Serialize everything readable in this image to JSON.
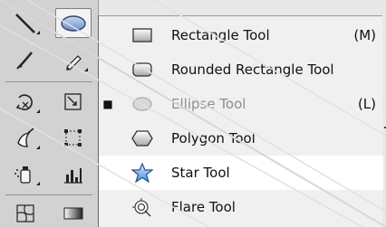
{
  "flyout": {
    "items": [
      {
        "label": "Rectangle Tool",
        "shortcut": "(M)",
        "checked": false,
        "dim": false,
        "selected": false
      },
      {
        "label": "Rounded Rectangle Tool",
        "shortcut": "",
        "checked": false,
        "dim": false,
        "selected": false
      },
      {
        "label": "Ellipse Tool",
        "shortcut": "(L)",
        "checked": true,
        "dim": true,
        "selected": false
      },
      {
        "label": "Polygon Tool",
        "shortcut": "",
        "checked": false,
        "dim": false,
        "selected": false
      },
      {
        "label": "Star Tool",
        "shortcut": "",
        "checked": false,
        "dim": false,
        "selected": true
      },
      {
        "label": "Flare Tool",
        "shortcut": "",
        "checked": false,
        "dim": false,
        "selected": false
      }
    ],
    "check_mark": "■"
  },
  "toolbar": {
    "tools": [
      {
        "name": "line-segment-tool"
      },
      {
        "name": "ellipse-tool"
      },
      {
        "name": "paintbrush-tool"
      },
      {
        "name": "pencil-tool"
      },
      {
        "name": "rotate-tool"
      },
      {
        "name": "scale-tool"
      },
      {
        "name": "warp-tool"
      },
      {
        "name": "free-transform-tool"
      },
      {
        "name": "symbol-sprayer-tool"
      },
      {
        "name": "column-graph-tool"
      },
      {
        "name": "mesh-tool"
      },
      {
        "name": "gradient-tool"
      }
    ]
  },
  "colors": {
    "menu_bg": "#f0f0f0",
    "selected_bg": "#ffffff",
    "toolbar_bg": "#d2d2d2",
    "accent_blue": "#4a8fd8"
  }
}
